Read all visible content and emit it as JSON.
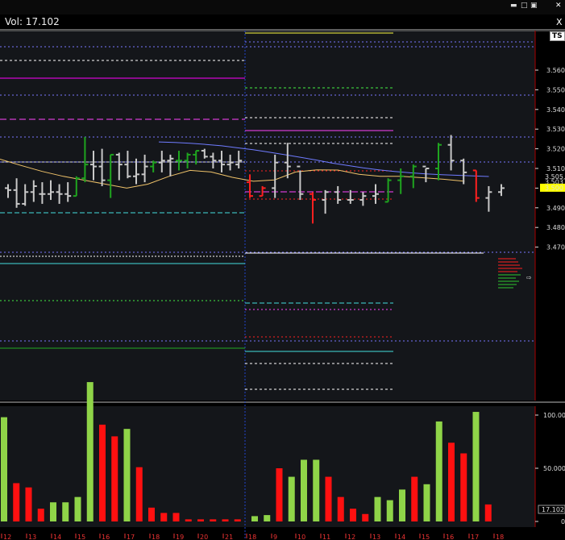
{
  "window": {
    "volume_label": "Vol: 17.102",
    "ts_badge": "TS",
    "close_label": "X"
  },
  "chart_data": [
    {
      "type": "bar",
      "subtype": "ohlc",
      "ylim": [
        3.464,
        3.572
      ],
      "y_ticks": [
        "3.560",
        "3.550",
        "3.540",
        "3.530",
        "3.520",
        "3.510",
        "3.500",
        "3.490",
        "3.480",
        "3.470"
      ],
      "price_labels": [
        {
          "text": "3.505,76",
          "value": 3.5058,
          "color": "#6f7bff"
        },
        {
          "text": "3.503",
          "value": 3.5032,
          "color": "#f0c36a"
        },
        {
          "text": "3.500",
          "value": 3.5002,
          "color": "#ffff00"
        }
      ],
      "candles": [
        {
          "o": 3.5,
          "h": 3.502,
          "l": 3.495,
          "c": 3.499,
          "col": "gray"
        },
        {
          "o": 3.499,
          "h": 3.505,
          "l": 3.49,
          "c": 3.492,
          "col": "gray"
        },
        {
          "o": 3.492,
          "h": 3.502,
          "l": 3.491,
          "c": 3.498,
          "col": "gray"
        },
        {
          "o": 3.498,
          "h": 3.504,
          "l": 3.493,
          "c": 3.501,
          "col": "gray"
        },
        {
          "o": 3.497,
          "h": 3.503,
          "l": 3.492,
          "c": 3.497,
          "col": "gray"
        },
        {
          "o": 3.497,
          "h": 3.504,
          "l": 3.494,
          "c": 3.498,
          "col": "gray"
        },
        {
          "o": 3.498,
          "h": 3.502,
          "l": 3.492,
          "c": 3.497,
          "col": "gray"
        },
        {
          "o": 3.497,
          "h": 3.503,
          "l": 3.493,
          "c": 3.496,
          "col": "gray"
        },
        {
          "o": 3.496,
          "h": 3.506,
          "l": 3.496,
          "c": 3.505,
          "col": "green"
        },
        {
          "o": 3.505,
          "h": 3.526,
          "l": 3.503,
          "c": 3.512,
          "col": "green"
        },
        {
          "o": 3.512,
          "h": 3.519,
          "l": 3.504,
          "c": 3.511,
          "col": "gray"
        },
        {
          "o": 3.511,
          "h": 3.52,
          "l": 3.501,
          "c": 3.504,
          "col": "gray"
        },
        {
          "o": 3.504,
          "h": 3.517,
          "l": 3.495,
          "c": 3.517,
          "col": "green"
        },
        {
          "o": 3.517,
          "h": 3.518,
          "l": 3.504,
          "c": 3.512,
          "col": "gray"
        },
        {
          "o": 3.512,
          "h": 3.519,
          "l": 3.505,
          "c": 3.506,
          "col": "gray"
        },
        {
          "o": 3.506,
          "h": 3.515,
          "l": 3.502,
          "c": 3.507,
          "col": "gray"
        },
        {
          "o": 3.507,
          "h": 3.517,
          "l": 3.503,
          "c": 3.511,
          "col": "gray"
        },
        {
          "o": 3.511,
          "h": 3.514,
          "l": 3.508,
          "c": 3.513,
          "col": "green"
        },
        {
          "o": 3.513,
          "h": 3.519,
          "l": 3.508,
          "c": 3.514,
          "col": "gray"
        },
        {
          "o": 3.514,
          "h": 3.517,
          "l": 3.506,
          "c": 3.515,
          "col": "gray"
        },
        {
          "o": 3.514,
          "h": 3.519,
          "l": 3.509,
          "c": 3.514,
          "col": "green"
        },
        {
          "o": 3.514,
          "h": 3.518,
          "l": 3.51,
          "c": 3.517,
          "col": "green"
        },
        {
          "o": 3.517,
          "h": 3.519,
          "l": 3.512,
          "c": 3.519,
          "col": "green"
        },
        {
          "o": 3.519,
          "h": 3.52,
          "l": 3.515,
          "c": 3.516,
          "col": "gray"
        },
        {
          "o": 3.516,
          "h": 3.518,
          "l": 3.51,
          "c": 3.514,
          "col": "gray"
        },
        {
          "o": 3.514,
          "h": 3.519,
          "l": 3.508,
          "c": 3.512,
          "col": "gray"
        },
        {
          "o": 3.512,
          "h": 3.517,
          "l": 3.509,
          "c": 3.513,
          "col": "gray"
        },
        {
          "o": 3.512,
          "h": 3.519,
          "l": 3.51,
          "c": 3.514,
          "col": "gray"
        },
        {
          "o": 3.503,
          "h": 3.507,
          "l": 3.495,
          "c": 3.496,
          "col": "red"
        },
        {
          "o": 3.496,
          "h": 3.501,
          "l": 3.496,
          "c": 3.5,
          "col": "red"
        },
        {
          "o": 3.5,
          "h": 3.517,
          "l": 3.495,
          "c": 3.513,
          "col": "gray"
        },
        {
          "o": 3.513,
          "h": 3.523,
          "l": 3.505,
          "c": 3.511,
          "col": "gray"
        },
        {
          "o": 3.511,
          "h": 3.509,
          "l": 3.494,
          "c": 3.497,
          "col": "gray"
        },
        {
          "o": 3.497,
          "h": 3.498,
          "l": 3.482,
          "c": 3.494,
          "col": "red"
        },
        {
          "o": 3.494,
          "h": 3.499,
          "l": 3.487,
          "c": 3.498,
          "col": "gray"
        },
        {
          "o": 3.498,
          "h": 3.501,
          "l": 3.492,
          "c": 3.494,
          "col": "gray"
        },
        {
          "o": 3.494,
          "h": 3.499,
          "l": 3.492,
          "c": 3.494,
          "col": "gray"
        },
        {
          "o": 3.494,
          "h": 3.498,
          "l": 3.491,
          "c": 3.496,
          "col": "gray"
        },
        {
          "o": 3.496,
          "h": 3.502,
          "l": 3.492,
          "c": 3.497,
          "col": "gray"
        },
        {
          "o": 3.493,
          "h": 3.505,
          "l": 3.493,
          "c": 3.504,
          "col": "green"
        },
        {
          "o": 3.504,
          "h": 3.51,
          "l": 3.497,
          "c": 3.506,
          "col": "green"
        },
        {
          "o": 3.506,
          "h": 3.512,
          "l": 3.5,
          "c": 3.511,
          "col": "green"
        },
        {
          "o": 3.511,
          "h": 3.51,
          "l": 3.503,
          "c": 3.51,
          "col": "gray"
        },
        {
          "o": 3.51,
          "h": 3.523,
          "l": 3.504,
          "c": 3.522,
          "col": "green"
        },
        {
          "o": 3.522,
          "h": 3.527,
          "l": 3.509,
          "c": 3.514,
          "col": "gray"
        },
        {
          "o": 3.514,
          "h": 3.515,
          "l": 3.502,
          "c": 3.508,
          "col": "gray"
        },
        {
          "o": 3.509,
          "h": 3.509,
          "l": 3.493,
          "c": 3.495,
          "col": "red"
        },
        {
          "o": 3.495,
          "h": 3.501,
          "l": 3.488,
          "c": 3.498,
          "col": "gray"
        },
        {
          "o": 3.498,
          "h": 3.502,
          "l": 3.496,
          "c": 3.5,
          "col": "gray"
        }
      ],
      "ma_blue": [
        3.5235,
        3.5232,
        3.5228,
        3.5222,
        3.5215,
        3.5205,
        3.5195,
        3.5183,
        3.517,
        3.5157,
        3.5143,
        3.5128,
        3.5115,
        3.5103,
        3.5093,
        3.5085,
        3.5078,
        3.5072,
        3.5068,
        3.5065,
        3.5062,
        3.5059
      ],
      "ma_tan": [
        3.5147,
        3.5115,
        3.5085,
        3.506,
        3.504,
        3.502,
        3.5,
        3.502,
        3.506,
        3.509,
        3.5082,
        3.5055,
        3.5035,
        3.5042,
        3.5082,
        3.5093,
        3.5092,
        3.507,
        3.506,
        3.506,
        3.5053,
        3.5045,
        3.5035
      ]
    },
    {
      "type": "bar",
      "series_name": "Vol",
      "ylim": [
        0,
        140000
      ],
      "y_ticks": [
        "100.000",
        "50.000",
        "0"
      ],
      "last_value": "17.102",
      "x_tick_labels": [
        "12",
        "13",
        "14",
        "15",
        "16",
        "17",
        "18",
        "19",
        "20",
        "21",
        "18",
        "9",
        "10",
        "11",
        "12",
        "13",
        "14",
        "15",
        "16",
        "17",
        "18"
      ],
      "values": [
        98000,
        36000,
        32000,
        12000,
        18000,
        18000,
        23000,
        131000,
        91000,
        80000,
        87000,
        51000,
        13000,
        8000,
        8000,
        2000,
        2000,
        2000,
        2000,
        2000,
        5000,
        6000,
        50000,
        42000,
        58000,
        58000,
        42000,
        23000,
        12000,
        7000,
        23000,
        20000,
        30000,
        42000,
        35000,
        94000,
        74000,
        64000,
        103000,
        16000
      ],
      "colors": [
        "green",
        "red",
        "red",
        "red",
        "green",
        "green",
        "green",
        "green",
        "red",
        "red",
        "green",
        "red",
        "red",
        "red",
        "red",
        "red",
        "red",
        "red",
        "red",
        "red",
        "green",
        "green",
        "red",
        "green",
        "green",
        "green",
        "red",
        "red",
        "red",
        "red",
        "green",
        "green",
        "green",
        "red",
        "green",
        "green",
        "red",
        "red",
        "green",
        "red"
      ]
    }
  ]
}
